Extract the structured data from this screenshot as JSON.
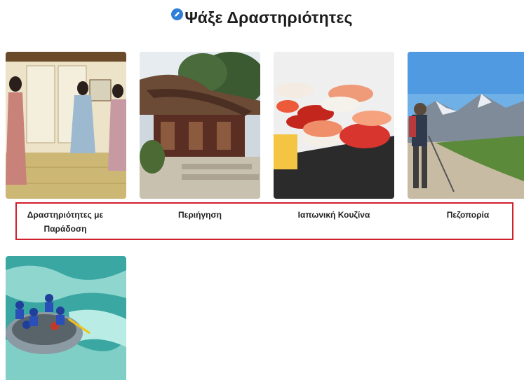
{
  "page": {
    "title": "Ψάξε Δραστηριότητες",
    "title_icon": "pencil-badge-icon",
    "accent_color": "#2f7fd8",
    "highlight_color": "#d0202c"
  },
  "activities": [
    {
      "label": "Δραστηριότητες με Παράδοση",
      "image": "traditional-dance-photo"
    },
    {
      "label": "Περιήγηση",
      "image": "shrine-photo"
    },
    {
      "label": "Ιαπωνική Κουζίνα",
      "image": "sushi-photo"
    },
    {
      "label": "Πεζοπορία",
      "image": "hiking-photo"
    },
    {
      "label": "",
      "image": "rafting-photo"
    }
  ]
}
